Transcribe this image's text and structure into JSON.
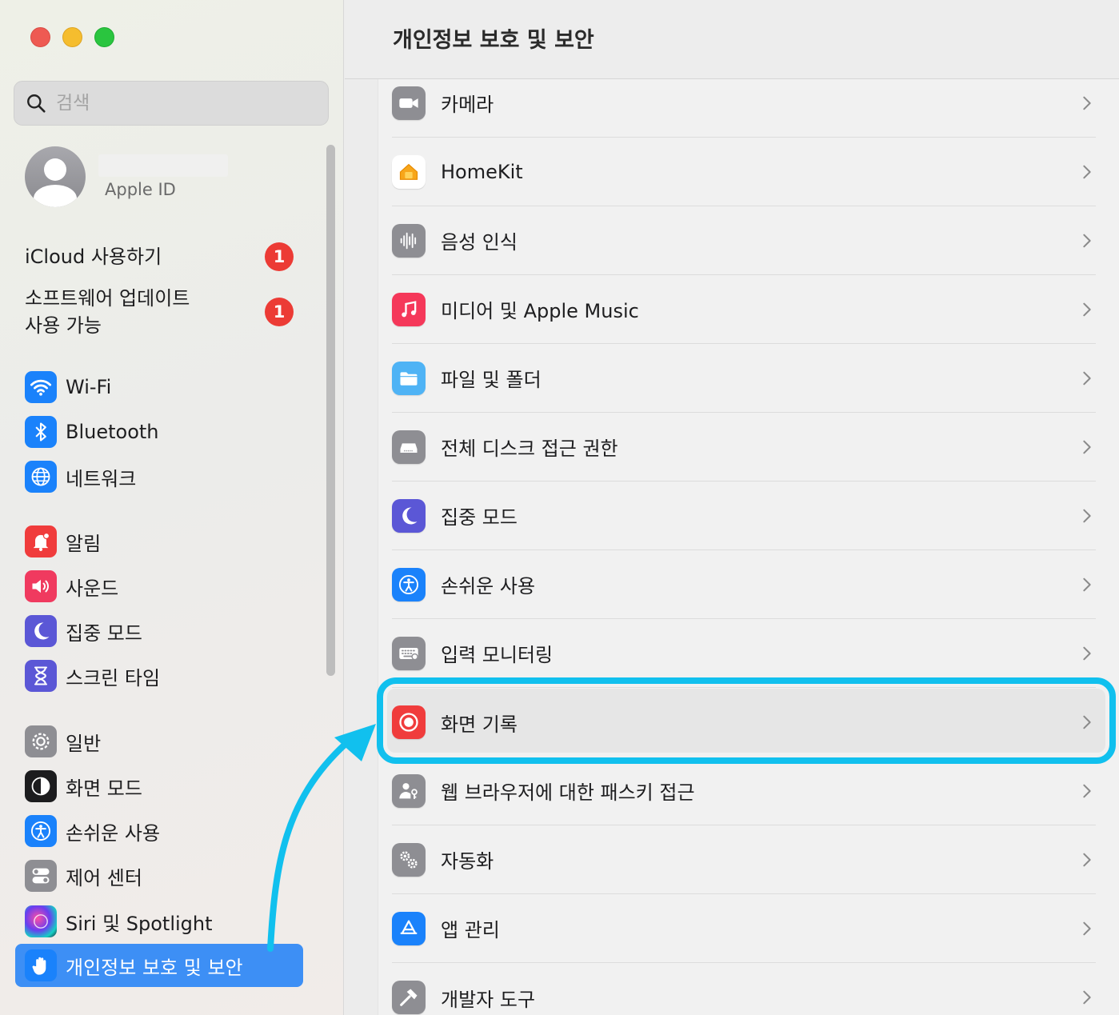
{
  "sidebar": {
    "search_placeholder": "검색",
    "account_label": "Apple ID",
    "notices": [
      {
        "label": "iCloud 사용하기",
        "badge": "1"
      },
      {
        "label_line1": "소프트웨어 업데이트",
        "label_line2": "사용 가능",
        "badge": "1"
      }
    ],
    "items": [
      {
        "label": "Wi-Fi",
        "icon": "wifi-icon",
        "color": "#1a82fb"
      },
      {
        "label": "Bluetooth",
        "icon": "bluetooth-icon",
        "color": "#1a82fb"
      },
      {
        "label": "네트워크",
        "icon": "globe-icon",
        "color": "#1a82fb"
      },
      {
        "label": "알림",
        "icon": "bell-icon",
        "color": "#f03c3c"
      },
      {
        "label": "사운드",
        "icon": "speaker-icon",
        "color": "#f03a5f"
      },
      {
        "label": "집중 모드",
        "icon": "moon-icon",
        "color": "#5b57d6"
      },
      {
        "label": "스크린 타임",
        "icon": "hourglass-icon",
        "color": "#5b57d6"
      },
      {
        "label": "일반",
        "icon": "gear-icon",
        "color": "#8e8e93"
      },
      {
        "label": "화면 모드",
        "icon": "appearance-icon",
        "color": "#1c1c1e"
      },
      {
        "label": "손쉬운 사용",
        "icon": "accessibility-icon",
        "color": "#1a82fb"
      },
      {
        "label": "제어 센터",
        "icon": "toggles-icon",
        "color": "#8e8e93"
      },
      {
        "label": "Siri 및 Spotlight",
        "icon": "siri-icon",
        "color": "#2b2b4a"
      },
      {
        "label": "개인정보 보호 및 보안",
        "icon": "hand-icon",
        "color": "#1a82fb",
        "selected": true
      }
    ]
  },
  "main": {
    "title": "개인정보 보호 및 보안",
    "rows": [
      {
        "label": "카메라",
        "icon": "camera-icon",
        "color": "#8e8e93"
      },
      {
        "label": "HomeKit",
        "icon": "home-icon",
        "color": "#ffffff"
      },
      {
        "label": "음성 인식",
        "icon": "waveform-icon",
        "color": "#8e8e93"
      },
      {
        "label": "미디어 및 Apple Music",
        "icon": "music-icon",
        "color": "#f5385a"
      },
      {
        "label": "파일 및 폴더",
        "icon": "folder-icon",
        "color": "#4fb3f5"
      },
      {
        "label": "전체 디스크 접근 권한",
        "icon": "disk-icon",
        "color": "#8e8e93"
      },
      {
        "label": "집중 모드",
        "icon": "moon-icon",
        "color": "#5b57d6"
      },
      {
        "label": "손쉬운 사용",
        "icon": "accessibility-icon",
        "color": "#1a82fb"
      },
      {
        "label": "입력 모니터링",
        "icon": "keyboard-icon",
        "color": "#8e8e93"
      },
      {
        "label": "화면 기록",
        "icon": "record-icon",
        "color": "#f03c3c",
        "highlighted": true
      },
      {
        "label": "웹 브라우저에 대한 패스키 접근",
        "icon": "passkey-icon",
        "color": "#8e8e93"
      },
      {
        "label": "자동화",
        "icon": "gears-icon",
        "color": "#8e8e93"
      },
      {
        "label": "앱 관리",
        "icon": "appstore-icon",
        "color": "#1a82fb"
      },
      {
        "label": "개발자 도구",
        "icon": "hammer-icon",
        "color": "#8e8e93"
      }
    ]
  },
  "colors": {
    "highlight": "#11c0ee",
    "selection": "#3d8ff5",
    "badge": "#ec3b35"
  }
}
